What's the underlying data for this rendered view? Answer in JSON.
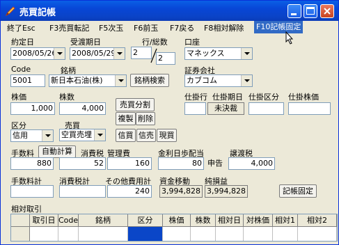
{
  "window": {
    "title": "売買記帳"
  },
  "menu": {
    "items": [
      "終了Esc",
      "F3売買転記",
      "F5次玉",
      "F6前玉",
      "F7戻る",
      "F8相対解除"
    ],
    "active": "F10記帳固定"
  },
  "form": {
    "yakujo_label": "約定日",
    "yakujo_value": "2008/05/26",
    "ukewatashi_label": "受渡期日",
    "ukewatashi_value": "2008/05/29",
    "gyo_label": "行/総数",
    "gyo_value": "2",
    "sosu_value": "2",
    "koza_label": "口座",
    "koza_value": "マネックス",
    "code_label": "Code",
    "code_value": "5001",
    "meigara_label": "銘柄",
    "meigara_value": "新日本石油(株)",
    "search_button": "銘柄検索",
    "shoken_label": "証券会社",
    "shoken_value": "カブコム",
    "kabuka_label": "株価",
    "kabuka_value": "1,000",
    "kabusu_label": "株数",
    "kabusu_value": "4,000",
    "split_button": "売買分割",
    "copy_button": "複製",
    "delete_button": "削除",
    "kakari_headers": [
      "仕掛行",
      "仕掛期日",
      "仕掛区分",
      "仕掛株価"
    ],
    "kakari_kijitsu_value": "未決裁",
    "kubun_label": "区分",
    "kubun_value": "信用",
    "baibai_label": "売買",
    "baibai_value": "空買売埋",
    "shingai_button": "信買",
    "shinbai_button": "信売",
    "genbai_button": "現買",
    "tesuryo_label": "手数料",
    "auto_calc_button": "自動計算",
    "tesuryo_value": "880",
    "shohizei_label": "消費税",
    "shohizei_value": "52",
    "kanrihi_label": "管理費",
    "kanrihi_value": "160",
    "kinri_label": "金利日歩配当",
    "kinri_value": "80",
    "shinkoku_label": "申告",
    "jotozei_label": "譲渡税",
    "jotozei_value": "4,000",
    "tesuryokei_label": "手数料計",
    "shohizeikei_label": "消費税計",
    "sonota_label": "その他費用計",
    "sonota_value": "240",
    "shikin_label": "資金移動",
    "shikin_value": "3,994,828",
    "sonneki_label": "純損益",
    "sonneki_value": "3,994,828",
    "kicho_button": "記帳固定"
  },
  "grid": {
    "title": "相対取引",
    "headers": [
      "",
      "取引日",
      "Code",
      "銘柄",
      "区分",
      "株価",
      "株数",
      "相対日",
      "対株価",
      "相対1",
      "相対2"
    ]
  }
}
